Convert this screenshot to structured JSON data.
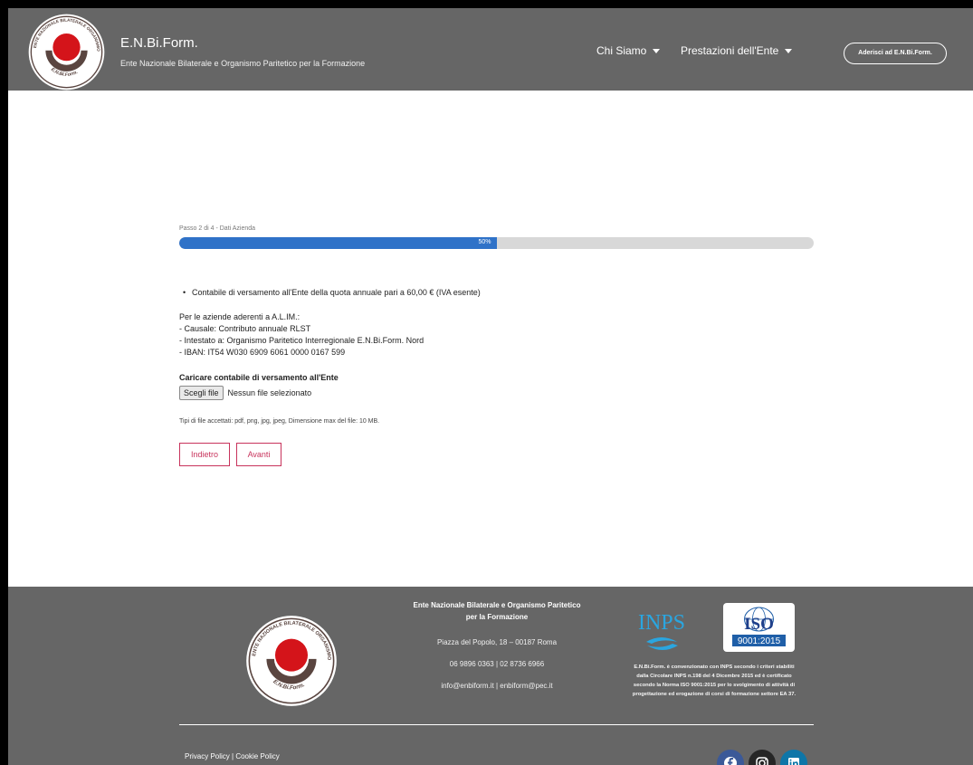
{
  "header": {
    "brand_title": "E.N.Bi.Form.",
    "brand_subtitle": "Ente Nazionale Bilaterale e Organismo Paritetico per la Formazione",
    "nav": [
      {
        "label": "Chi Siamo"
      },
      {
        "label": "Prestazioni dell'Ente"
      }
    ],
    "join_button": "Aderisci ad E.N.Bi.Form."
  },
  "logo": {
    "ring_text": "ENTE NAZIONALE BILATERALE ORGANISMO PARITETICO",
    "bottom_text": "E.N.Bi.Form."
  },
  "form": {
    "step_label": "Passo 2 di 4 - Dati Azienda",
    "progress": 50,
    "progress_label": "50%",
    "bullet": "Contabile di versamento all'Ente della quota annuale pari a 60,00 € (IVA esente)",
    "info_lines": [
      "Per le aziende aderenti a A.L.IM.:",
      "- Causale: Contributo annuale RLST",
      "- Intestato a: Organismo Paritetico Interregionale E.N.Bi.Form. Nord",
      "- IBAN: IT54 W030 6909 6061 0000 0167 599"
    ],
    "upload_heading": "Caricare contabile di versamento all'Ente",
    "file_button": "Scegli file",
    "file_status": "Nessun file selezionato",
    "file_hint": "Tipi di file accettati: pdf, png, jpg, jpeg, Dimensione max del file: 10 MB.",
    "back_button": "Indietro",
    "next_button": "Avanti"
  },
  "footer": {
    "title_line1": "Ente Nazionale Bilaterale e Organismo Paritetico",
    "title_line2": "per la Formazione",
    "address": "Piazza del Popolo, 18 – 00187 Roma",
    "phones": "06 9896 0363  |  02 8736 6966",
    "emails": "info@enbiform.it  |  enbiform@pec.it",
    "inps_text": "INPS",
    "iso_text": "ISO",
    "iso_cert": "9001:2015",
    "note_lines": [
      "E.N.Bi.Form. è convenzionato con INPS secondo i criteri stabiliti",
      "dalla Circolare INPS n.198 del 4 Dicembre 2015 ed è certificato",
      "secondo la Norma ISO 9001:2015 per lo svolgimento di attività di",
      "progettazione ed erogazione di corsi di formazione settore EA 37."
    ],
    "policy": "Privacy Policy | Cookie Policy",
    "social": [
      "facebook-icon",
      "instagram-icon",
      "linkedin-icon"
    ]
  },
  "colors": {
    "header_bg": "#666666",
    "accent_blue": "#2f72c8",
    "button_red": "#c8335c",
    "logo_red": "#d4141a",
    "logo_brown": "#5a4540"
  }
}
